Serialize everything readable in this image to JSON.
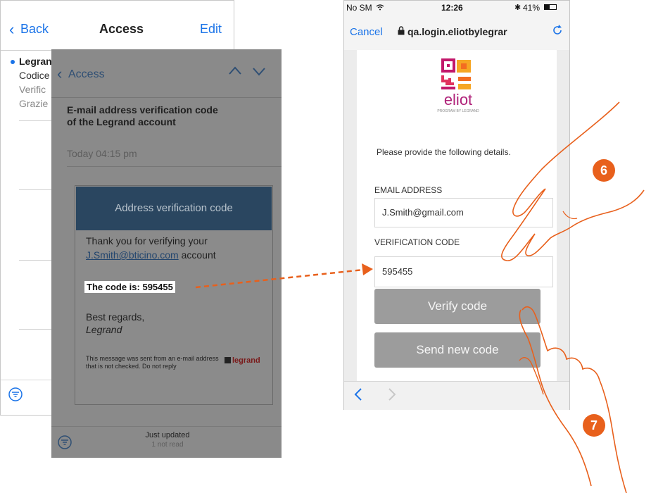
{
  "mail_list": {
    "back_label": "Back",
    "title": "Access",
    "edit_label": "Edit",
    "preview_sender": "Legrand",
    "preview_line1": "Codice",
    "preview_line2": "Verific",
    "preview_line3": "Grazie"
  },
  "email": {
    "back_label": "Access",
    "subject": "E-mail address verification code of the Legrand account",
    "date": "Today 04:15 pm",
    "card_title": "Address verification code",
    "body_line1": "Thank you for verifying your",
    "email_link": "J.Smith@bticino.com",
    "body_line2": "account",
    "code_text": "The code is: 595455",
    "regards": "Best regards,",
    "signature": "Legrand",
    "footer_note": "This message was sent from an e-mail address that is not checked. Do not reply",
    "brand": "legrand",
    "footer_status": "Just updated",
    "footer_unread": "1 not read"
  },
  "phone": {
    "carrier": "No SM",
    "time": "12:26",
    "battery": "41%",
    "cancel_label": "Cancel",
    "url": "qa.login.eliotbylegrar",
    "logo_text": "eliot",
    "logo_sub": "PROGRAM BY LEGRAND",
    "prompt": "Please provide the following details.",
    "email_label": "EMAIL ADDRESS",
    "email_value": "J.Smith@gmail.com",
    "code_label": "VERIFICATION CODE",
    "code_value": "595455",
    "verify_label": "Verify code",
    "resend_label": "Send new code"
  },
  "callouts": {
    "step6": "6",
    "step7": "7"
  },
  "colors": {
    "ios_blue": "#1a73e8",
    "accent_orange": "#e8601c",
    "card_header": "#2a4660",
    "overlay_gray": "#8a8a8a"
  }
}
